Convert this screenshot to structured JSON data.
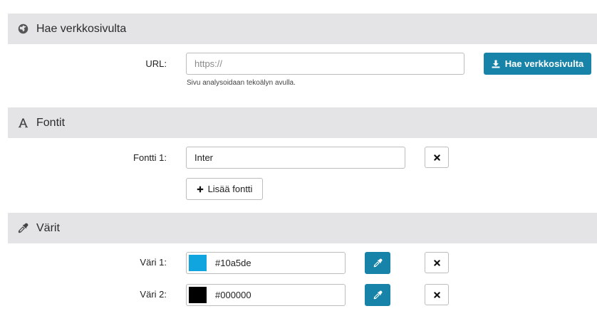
{
  "fetch_section": {
    "title": "Hae verkkosivulta",
    "url_label": "URL:",
    "url_value": "",
    "url_placeholder": "https://",
    "help_text": "Sivu analysoidaan tekoälyn avulla.",
    "fetch_button_label": "Hae verkkosivulta",
    "icon": "globe-icon"
  },
  "fonts_section": {
    "title": "Fontit",
    "icon": "font-icon",
    "fonts": [
      {
        "label": "Fontti 1:",
        "value": "Inter"
      }
    ],
    "add_font_label": "Lisää fontti"
  },
  "colors_section": {
    "title": "Värit",
    "icon": "eyedropper-icon",
    "colors": [
      {
        "label": "Väri 1:",
        "hex": "#10a5de",
        "swatch": "#10a5de"
      },
      {
        "label": "Väri 2:",
        "hex": "#000000",
        "swatch": "#000000"
      }
    ]
  },
  "theme": {
    "accent": "#1783a8",
    "header_bg": "#e4e4e7"
  }
}
